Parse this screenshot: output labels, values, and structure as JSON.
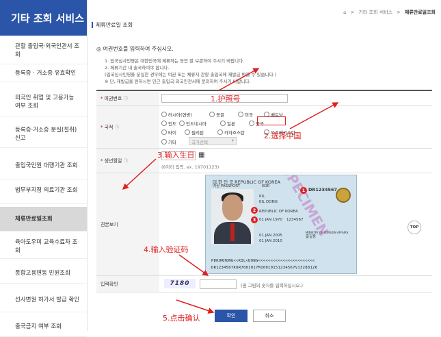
{
  "sidebar": {
    "title": "기타 조회 서비스",
    "items": [
      {
        "label": "관할 출입국·외국인관서 조회"
      },
      {
        "label": "등록증 · 거소증 유효확인"
      },
      {
        "label": "외국인 취업 및 고용가능 여부 조회"
      },
      {
        "label": "등록증·거소증 분실(절취) 신고"
      },
      {
        "label": "출입국민원 대행기관 조회"
      },
      {
        "label": "법무부지정 의료기관 조회"
      },
      {
        "label": "체류만료일조회"
      },
      {
        "label": "육아도우미 교육수료자 조회"
      },
      {
        "label": "통합고용변동 민원조회"
      },
      {
        "label": "선사변원 허가서 발급 확인"
      },
      {
        "label": "출국금지 여부 조회"
      }
    ]
  },
  "breadcrumb": {
    "home": "⌂",
    "sep": ">",
    "parent": "기타 조회 서비스",
    "current": "체류만료일조회"
  },
  "page_title": "체류만료일 조회",
  "guide": {
    "heading": "◎ 여권번호를 입력하여 주십시오.",
    "lines": [
      "1. 입국심사인영은 대한민국에 체류하는 동안 잘 보관하여 주시기 바랍니다.",
      "2. 체류기간 내 출국하여야 합니다.",
      "(입국심사인영을 분실한 경우에는 여권 또는 체류지 관할 출입국에 재발급 받을 수 있습니다.)",
      "※ 단, 재발급을 원하시면 인근 출입국·외국인관서에 문의하여 주시기 바랍니다."
    ]
  },
  "form": {
    "passport_label": "여권번호",
    "nationality_label": "국적",
    "nationality_options": [
      "러시아(연방)",
      "몽골",
      "미국",
      "베트남",
      "인도",
      "인도네시아",
      "일본",
      "중국",
      "타이",
      "필리핀",
      "카자흐스탄",
      "우즈베키스탄",
      "기타"
    ],
    "country_select": "국가선택",
    "birth_label": "생년월일",
    "birth_hint": "(8자리 입력. ex. 19701123)",
    "sample_label": "견본보기",
    "captcha_label": "입력확인",
    "captcha_value": "7180",
    "captcha_hint": "(옆 그림의 숫자를 입력하십시오.)",
    "confirm_button": "확인",
    "cancel_button": "취소"
  },
  "passport": {
    "header": "대 한 민 국   REPUBLIC OF KOREA",
    "type": "여권 PASSPORT",
    "code": "KOR",
    "number": "DR1234567",
    "surname": "KIL",
    "given": "KIL DONG",
    "nationality": "REPUBLIC OF KOREA",
    "birth": "01 JAN 1970",
    "sex": "M",
    "issue": "01 JAN 2005",
    "expiry": "01 JAN 2010",
    "personal_no": "1234567",
    "authority": "MINISTRY OF FOREIGN AFFAIRS",
    "korean_name": "홍길동",
    "watermark": "SPECIMEN",
    "mrz1": "PDKORHONG<<KIL<DONG<<<<<<<<<<<<<<<<<<<<<<<",
    "mrz2": "DR1234567KOR7001017M10010151234567V13288126"
  },
  "top_button": "TOP",
  "annotations": {
    "step1": "1.护照号",
    "step2": "2.选择中国",
    "step3": "3.输入生日",
    "step4": "4.输入验证码",
    "step5": "5.点击确认"
  },
  "colors": {
    "brand": "#2a55a8",
    "annotation": "#e02020"
  }
}
